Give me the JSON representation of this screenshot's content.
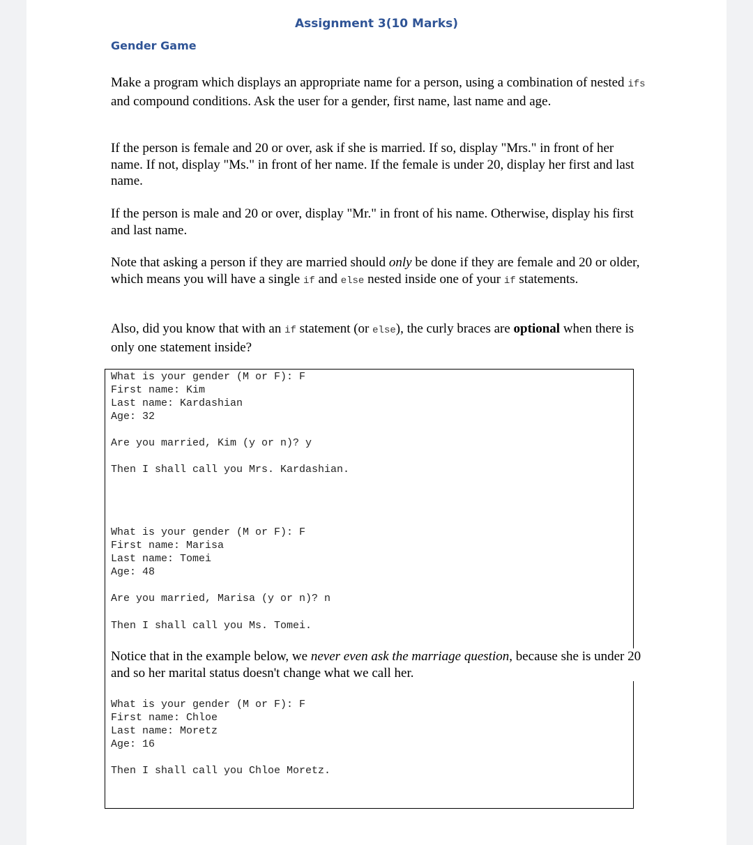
{
  "header": {
    "title": "Assignment 3(10 Marks)",
    "subtitle": "Gender Game"
  },
  "paragraphs": {
    "p1": {
      "before_code": "Make a program which displays an appropriate name for a person, using a combination of nested ",
      "code": "ifs",
      "after_code": " and compound conditions. Ask the user for a gender, first name, last name and age."
    },
    "p2": "If the person is female and 20 or over, ask if she is married. If so, display \"Mrs.\" in front of her name. If not, display \"Ms.\" in front of her name. If the female is under 20, display her first and last name.",
    "p3": "If the person is male and 20 or over, display \"Mr.\" in front of his name. Otherwise, display his first and last name.",
    "p4": {
      "part1": "Note that asking a person if they are married should ",
      "emph": "only",
      "part2": " be done if they are female and 20 or older, which means you will have a single ",
      "code1": "if",
      "part3": " and ",
      "code2": "else",
      "part4": " nested inside one of your ",
      "code3": "if",
      "part5": " statements."
    },
    "p5": {
      "part1": "Also, did you know that with an ",
      "code1": "if",
      "part2": " statement (or ",
      "code2": "else",
      "part3": "), the curly braces are ",
      "strong": "optional",
      "part4": " when there is only one statement inside?"
    },
    "p6": {
      "part1": "Notice that in the example below, we ",
      "emph": "never even ask the marriage question",
      "part2": ", because she is under 20 and so her marital status doesn't change what we call her."
    }
  },
  "console": {
    "example1": [
      "What is your gender (M or F): F",
      "First name: Kim",
      "Last name: Kardashian",
      "Age: 32",
      "Are you married, Kim (y or n)? y",
      "Then I shall call you Mrs. Kardashian."
    ],
    "example2": [
      "What is your gender (M or F): F",
      "First name: Marisa",
      "Last name: Tomei",
      "Age: 48",
      "Are you married, Marisa (y or n)? n",
      "Then I shall call you Ms. Tomei."
    ],
    "example3": [
      "What is your gender (M or F): F",
      "First name: Chloe",
      "Last name: Moretz",
      "Age: 16",
      "Then I shall call you Chloe Moretz."
    ]
  }
}
